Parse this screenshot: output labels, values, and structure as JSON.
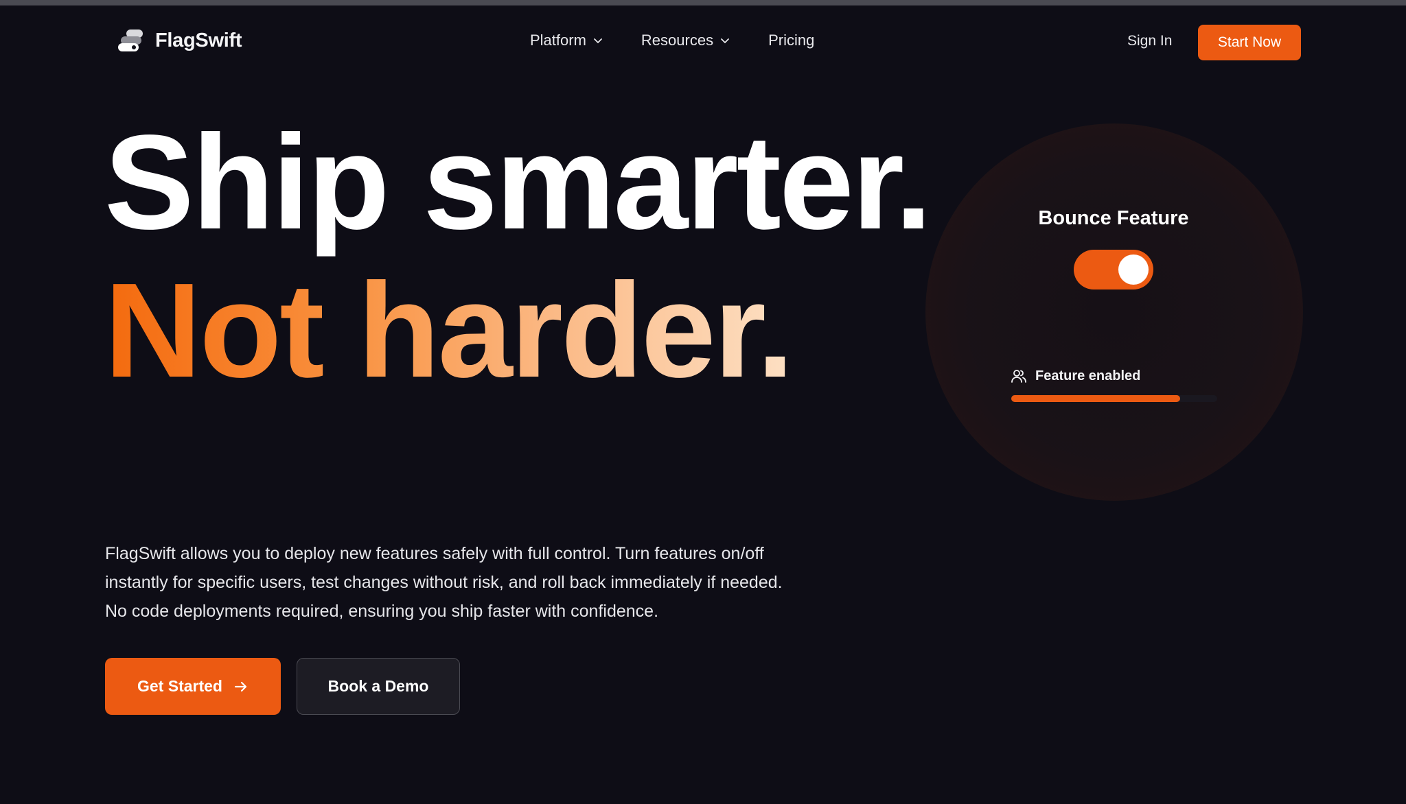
{
  "brand": {
    "name": "FlagSwift",
    "logo_icon": "flag-stack-logo"
  },
  "nav": {
    "links": [
      {
        "label": "Platform",
        "has_dropdown": true
      },
      {
        "label": "Resources",
        "has_dropdown": true
      },
      {
        "label": "Pricing",
        "has_dropdown": false
      }
    ],
    "sign_in": "Sign In",
    "start_now": "Start Now"
  },
  "hero": {
    "line1": "Ship smarter.",
    "line2": "Not harder."
  },
  "feature_card": {
    "title": "Bounce Feature",
    "toggle_on": true,
    "status_icon": "users-icon",
    "status": "Feature enabled",
    "progress": 0.82
  },
  "description": {
    "lines": [
      "FlagSwift allows you to deploy new features safely with full control. Turn features on/off",
      "instantly for specific users, test changes without risk, and roll back immediately if needed.",
      "No code deployments required, ensuring you ship faster with confidence."
    ]
  },
  "cta": {
    "primary": "Get Started",
    "primary_icon": "arrow-right-icon",
    "secondary": "Book a Demo"
  },
  "colors": {
    "accent": "#ec5a12",
    "background": "#0e0d16",
    "gradient": [
      "#f46a0e",
      "#f9913f",
      "#fbb985",
      "#fde0c4"
    ]
  }
}
